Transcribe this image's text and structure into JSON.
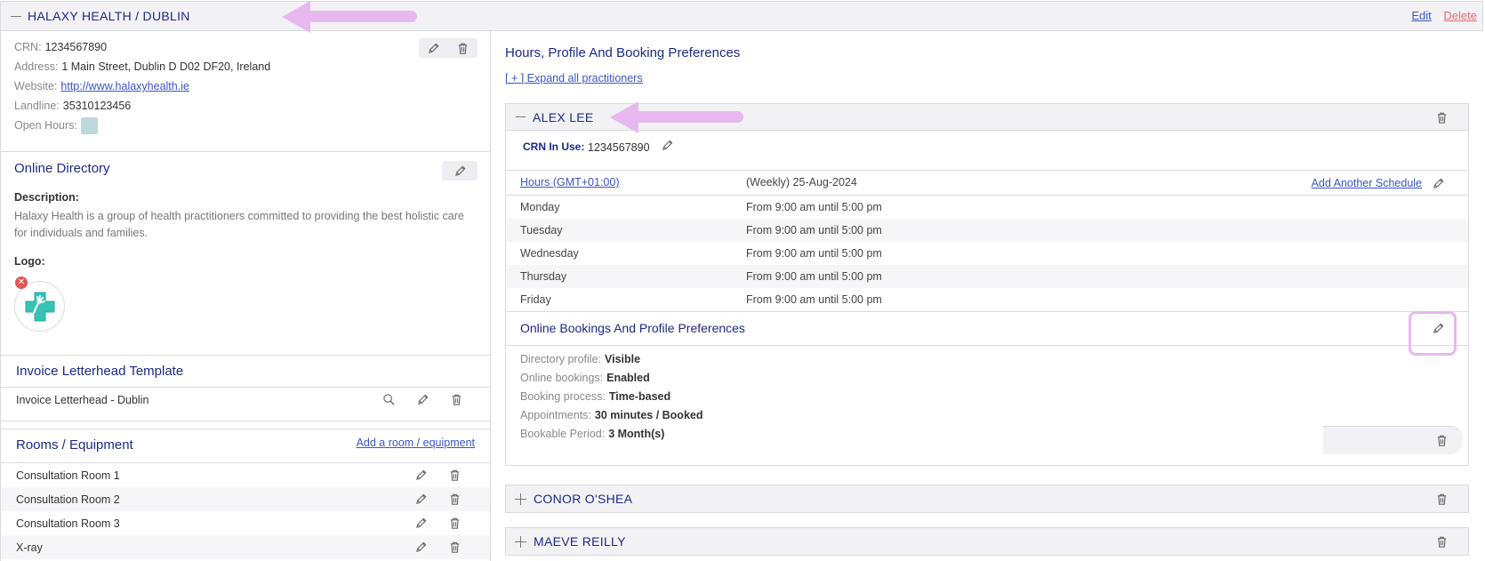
{
  "header": {
    "title": "HALAXY HEALTH / DUBLIN",
    "edit_label": "Edit",
    "delete_label": "Delete"
  },
  "details": {
    "crn_label": "CRN:",
    "crn_value": "1234567890",
    "address_label": "Address:",
    "address_value": "1 Main Street, Dublin D D02 DF20, Ireland",
    "website_label": "Website:",
    "website_value": "http://www.halaxyhealth.ie",
    "landline_label": "Landline:",
    "landline_value": "35310123456",
    "open_hours_label": "Open Hours:"
  },
  "online_directory": {
    "title": "Online Directory",
    "description_label": "Description:",
    "description_value": "Halaxy Health is a group of health practitioners committed to providing the best holistic care for individuals and families.",
    "logo_label": "Logo:"
  },
  "invoice": {
    "title": "Invoice Letterhead Template",
    "item": "Invoice Letterhead - Dublin"
  },
  "rooms": {
    "title": "Rooms / Equipment",
    "add_label": "Add a room / equipment",
    "items": [
      "Consultation Room 1",
      "Consultation Room 2",
      "Consultation Room 3",
      "X-ray"
    ]
  },
  "right": {
    "title": "Hours, Profile And Booking Preferences",
    "expand_label": "[ + ] Expand all practitioners"
  },
  "practitioner": {
    "name": "ALEX LEE",
    "crn_label": "CRN In Use:",
    "crn_value": "1234567890",
    "hours_link": "Hours (GMT+01:00)",
    "schedule_label": "(Weekly) 25-Aug-2024",
    "add_schedule_label": "Add Another Schedule",
    "schedule": [
      {
        "day": "Monday",
        "time": "From 9:00 am until 5:00 pm"
      },
      {
        "day": "Tuesday",
        "time": "From 9:00 am until 5:00 pm"
      },
      {
        "day": "Wednesday",
        "time": "From 9:00 am until 5:00 pm"
      },
      {
        "day": "Thursday",
        "time": "From 9:00 am until 5:00 pm"
      },
      {
        "day": "Friday",
        "time": "From 9:00 am until 5:00 pm"
      }
    ],
    "prefs_title": "Online Bookings And Profile Preferences",
    "prefs": [
      {
        "label": "Directory profile:",
        "value": "Visible"
      },
      {
        "label": "Online bookings:",
        "value": "Enabled"
      },
      {
        "label": "Booking process:",
        "value": "Time-based"
      },
      {
        "label": "Appointments:",
        "value": "30 minutes / Booked"
      },
      {
        "label": "Bookable Period:",
        "value": "3 Month(s)"
      }
    ]
  },
  "others": [
    "CONOR O'SHEA",
    "MAEVE REILLY"
  ],
  "colors": {
    "navy": "#1c2a86",
    "link": "#3a55c8",
    "delete": "#e06b6b",
    "highlight": "#e7b8ef"
  }
}
